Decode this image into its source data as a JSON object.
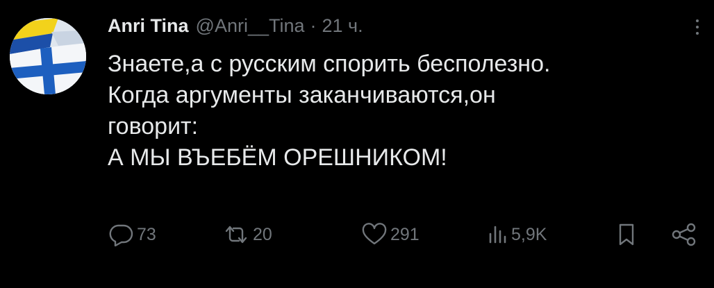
{
  "tweet": {
    "author_name": "Anri Tina",
    "author_handle": "@Anri__Tina",
    "separator": "·",
    "time": "21 ч.",
    "text_lines": [
      "Знаете,а с русским спорить бесполезно.",
      "Когда аргументы заканчиваются,он",
      "говорит:",
      "А МЫ ВЪЕБЁМ ОРЕШНИКОМ!"
    ]
  },
  "actions": {
    "replies": "73",
    "retweets": "20",
    "likes": "291",
    "views": "5,9K"
  },
  "icons": {
    "avatar": "flag-avatar",
    "more": "more-options-icon",
    "reply": "reply-icon",
    "retweet": "retweet-icon",
    "like": "heart-icon",
    "views": "views-icon",
    "bookmark": "bookmark-icon",
    "share": "share-icon"
  },
  "colors": {
    "background": "#000000",
    "text_primary": "#e7e9ea",
    "text_secondary": "#71767b",
    "flag_blue": "#1c4fa8",
    "flag_yellow": "#f2d21b"
  }
}
